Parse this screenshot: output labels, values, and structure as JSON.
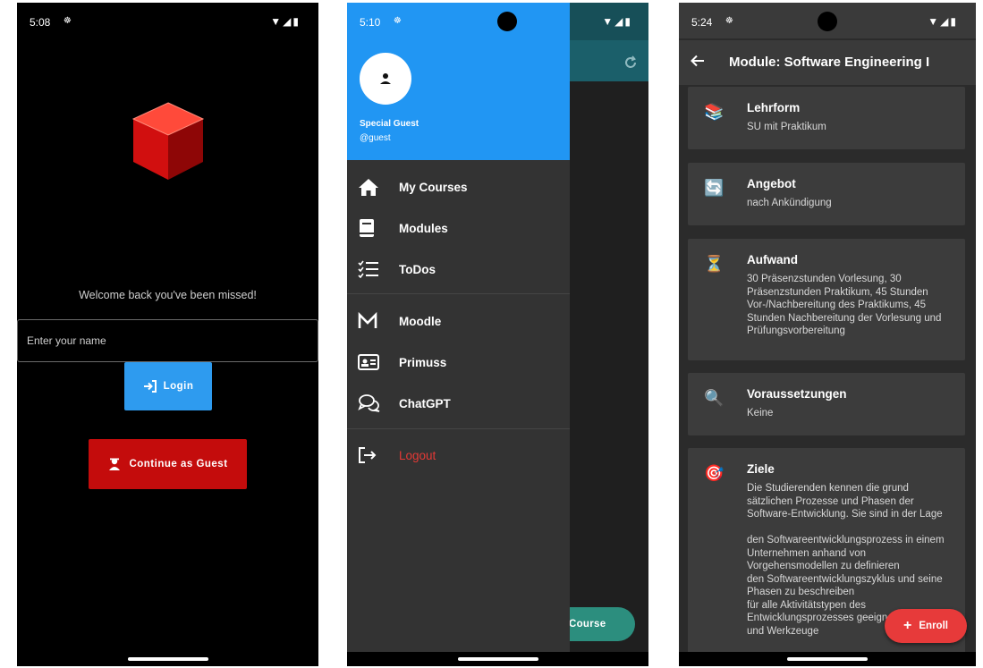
{
  "screens": {
    "login": {
      "status": {
        "time": "5:08",
        "notif": "☸"
      },
      "welcome": "Welcome back you've been missed!",
      "name_placeholder": "Enter your name",
      "login_label": "Login",
      "guest_label": "Continue as Guest"
    },
    "drawer": {
      "status": {
        "time": "5:10",
        "notif": "☸"
      },
      "user": {
        "name": "Special Guest",
        "handle": "@guest"
      },
      "menu": [
        {
          "label": "My Courses",
          "icon": "home-icon"
        },
        {
          "label": "Modules",
          "icon": "book-icon"
        },
        {
          "label": "ToDos",
          "icon": "checklist-icon"
        },
        {
          "label": "Moodle",
          "icon": "moodle-icon"
        },
        {
          "label": "Primuss",
          "icon": "id-card-icon"
        },
        {
          "label": "ChatGPT",
          "icon": "chat-icon"
        },
        {
          "label": "Logout",
          "icon": "logout-icon"
        }
      ],
      "fab_label": "Course"
    },
    "module": {
      "status": {
        "time": "5:24",
        "notif": "☸"
      },
      "title": "Module: Software Engineering I",
      "cards": [
        {
          "title": "Lehrform",
          "body": "SU mit Praktikum",
          "icon": "books-icon"
        },
        {
          "title": "Angebot",
          "body": "nach Ankündigung",
          "icon": "repeat-icon"
        },
        {
          "title": "Aufwand",
          "body": "30 Präsenzstunden Vorlesung, 30 Präsenzstunden Praktikum, 45 Stunden Vor-/Nachbereitung des Praktikums, 45 Stunden Nachbereitung der Vorlesung und Prüfungsvorbereitung",
          "icon": "hourglass-icon"
        },
        {
          "title": "Voraussetzungen",
          "body": "Keine",
          "icon": "magnifier-icon"
        },
        {
          "title": "Ziele",
          "body": "Die Studierenden kennen die grund sätzlichen Prozesse und Phasen der Software-Entwicklung. Sie sind in der Lage\n\n den Softwareentwicklungsprozess in einem Unternehmen anhand von Vorgehensmodellen zu definieren\n den Softwareentwicklungszyklus und seine Phasen zu beschreiben\n für alle Aktivitätstypen des Entwicklungsprozesses geeignete Methoden und Werkzeuge",
          "icon": "target-icon"
        }
      ],
      "fab_label": "Enroll"
    }
  },
  "colors": {
    "primary": "#2196f3",
    "login_button": "#2e9bef",
    "guest_button": "#c40c0c",
    "logout_text": "#e53935",
    "enroll_fab": "#e73a3a"
  }
}
